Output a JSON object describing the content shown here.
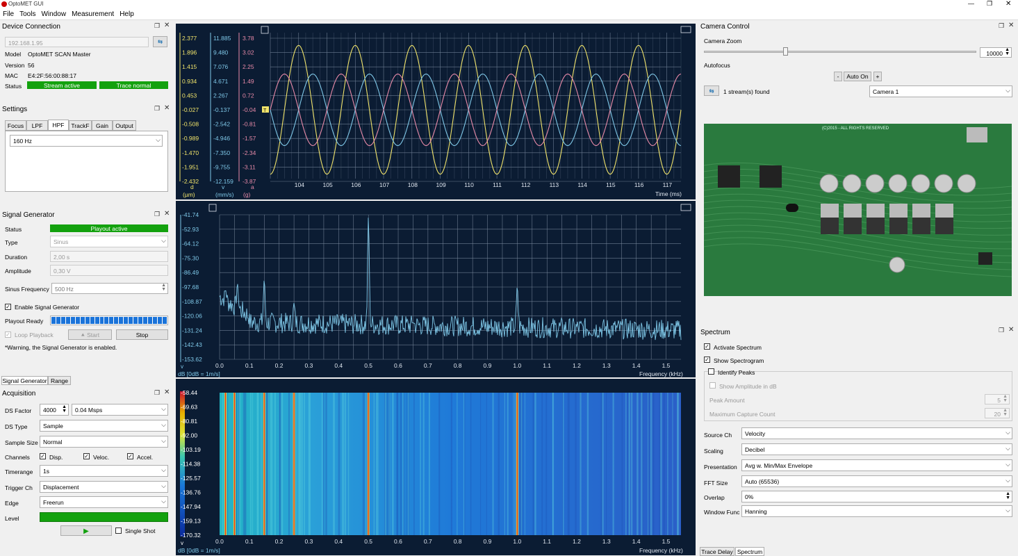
{
  "app": {
    "title": "OptoMET GUI",
    "menu": [
      "File",
      "Tools",
      "Window",
      "Measurement",
      "Help"
    ]
  },
  "device": {
    "title": "Device Connection",
    "ip": "192.168.1.95",
    "model_label": "Model",
    "model": "OptoMET SCAN Master",
    "version_label": "Version",
    "version": "56",
    "mac_label": "MAC",
    "mac": "E4:2F:56:00:88:17",
    "status_label": "Status",
    "stream": "Stream active",
    "trace": "Trace normal"
  },
  "settings": {
    "title": "Settings",
    "tabs": [
      "Focus",
      "LPF",
      "HPF",
      "TrackF",
      "Gain",
      "Output"
    ],
    "active_tab": "HPF",
    "hpf_value": "160 Hz"
  },
  "siggen": {
    "title": "Signal Generator",
    "status_label": "Status",
    "status": "Playout active",
    "type_label": "Type",
    "type": "Sinus",
    "duration_label": "Duration",
    "duration": "2,00 s",
    "amplitude_label": "Amplitude",
    "amplitude": "0,30 V",
    "freq_label": "Sinus Frequency",
    "freq": "500 Hz",
    "enable_label": "Enable Signal Generator",
    "ready_label": "Playout Ready",
    "loop_label": "Loop Playback",
    "start": "Start",
    "stop": "Stop",
    "warning": "*Warning, the Signal Generator is enabled.",
    "ready_segments": 24
  },
  "bottom_tabs": [
    "Signal Generator",
    "Range"
  ],
  "acq": {
    "title": "Acquisition",
    "ds_factor_label": "DS Factor",
    "ds_factor": "4000",
    "ds_rate": "0.04 Msps",
    "ds_type_label": "DS Type",
    "ds_type": "Sample",
    "sample_size_label": "Sample Size",
    "sample_size": "Normal",
    "channels_label": "Channels",
    "ch_disp": "Disp.",
    "ch_veloc": "Veloc.",
    "ch_accel": "Accel.",
    "timerange_label": "Timerange",
    "timerange": "1s",
    "trigger_label": "Trigger Ch",
    "trigger": "Displacement",
    "edge_label": "Edge",
    "edge": "Freerun",
    "level_label": "Level",
    "single_shot": "Single Shot"
  },
  "camera": {
    "title": "Camera Control",
    "zoom_label": "Camera Zoom",
    "zoom": "10000",
    "zoom_level": 0.3,
    "autofocus_label": "Autofocus",
    "minus": "-",
    "auto_on": "Auto On",
    "plus": "+",
    "streams": "1 stream(s) found",
    "camera": "Camera 1",
    "pcb_text": "(C)2015 - ALL RIGHTS RESERVED"
  },
  "spectrum": {
    "title": "Spectrum",
    "activate": "Activate Spectrum",
    "show_spectrogram": "Show Spectrogram",
    "identify_peaks": "Identify Peaks",
    "show_amp": "Show Amplitude in dB",
    "peak_amount_label": "Peak Amount",
    "peak_amount": "5",
    "max_capture_label": "Maximum Capture Count",
    "max_capture": "20",
    "source_label": "Source Ch",
    "source": "Velocity",
    "scaling_label": "Scaling",
    "scaling": "Decibel",
    "presentation_label": "Presentation",
    "presentation": "Avg w. Min/Max Envelope",
    "fft_label": "FFT Size",
    "fft": "Auto (65536)",
    "overlap_label": "Overlap",
    "overlap": "0%",
    "window_label": "Window Func",
    "window": "Hanning",
    "bottom_tabs": [
      "Trace Delay",
      "Spectrum"
    ]
  },
  "colors": {
    "plot_bg": "#0b1c33",
    "disp": "#f0e36a",
    "veloc": "#7fc8e8",
    "accel": "#e88aa8",
    "green": "#13a10e"
  },
  "chart_data": [
    {
      "type": "line",
      "title": "",
      "xlabel": "Time (ms)",
      "xlim": [
        103,
        117.5
      ],
      "x_ticks": [
        "104",
        "105",
        "106",
        "107",
        "108",
        "109",
        "110",
        "111",
        "112",
        "113",
        "114",
        "115",
        "116",
        "117"
      ],
      "axes": [
        {
          "label": "d",
          "unit": "(µm)",
          "ticks": [
            "2.377",
            "1.896",
            "1.415",
            "0.934",
            "0.453",
            "-0.027",
            "-0.508",
            "-0.989",
            "-1.470",
            "-1.951",
            "-2.432"
          ]
        },
        {
          "label": "v",
          "unit": "(mm/s)",
          "ticks": [
            "11.885",
            "9.480",
            "7.076",
            "4.671",
            "2.267",
            "-0.137",
            "-2.542",
            "-4.946",
            "-7.350",
            "-9.755",
            "-12.159"
          ]
        },
        {
          "label": "a",
          "unit": "(g)",
          "ticks": [
            "3.78",
            "3.02",
            "2.25",
            "1.49",
            "0.72",
            "-0.04",
            "-0.81",
            "-1.57",
            "-2.34",
            "-3.11",
            "-3.87"
          ]
        }
      ],
      "series": [
        {
          "frequency_hz": 500,
          "amplitude_fraction": 0.9,
          "phase": 1.57
        },
        {
          "frequency_hz": 500,
          "amplitude_fraction": 0.5,
          "phase": 0
        },
        {
          "frequency_hz": 500,
          "amplitude_fraction": 0.5,
          "phase": 3.14
        }
      ],
      "trigger_marker": "T"
    },
    {
      "type": "line",
      "title": "",
      "xlabel": "Frequency (kHz)",
      "ylabel": "dB [0dB = 1m/s]",
      "y_axis_name": "v",
      "xlim": [
        0,
        1.55
      ],
      "ylim": [
        -153.62,
        -41.74
      ],
      "x_ticks": [
        "0.0",
        "0.1",
        "0.2",
        "0.3",
        "0.4",
        "0.5",
        "0.6",
        "0.7",
        "0.8",
        "0.9",
        "1.0",
        "1.1",
        "1.2",
        "1.3",
        "1.4",
        "1.5"
      ],
      "y_ticks": [
        "-41.74",
        "-52.93",
        "-64.12",
        "-75.30",
        "-86.49",
        "-97.68",
        "-108.87",
        "-120.06",
        "-131.24",
        "-142.43",
        "-153.62"
      ],
      "peaks": [
        {
          "x": 0.02,
          "y": -100
        },
        {
          "x": 0.06,
          "y": -95
        },
        {
          "x": 0.15,
          "y": -92
        },
        {
          "x": 0.25,
          "y": -110
        },
        {
          "x": 0.5,
          "y": -43
        },
        {
          "x": 0.65,
          "y": -125
        },
        {
          "x": 1.0,
          "y": -97
        }
      ]
    },
    {
      "type": "heatmap",
      "title": "",
      "xlabel": "Frequency (kHz)",
      "ylabel": "dB [0dB = 1m/s]",
      "y_axis_name": "v",
      "x_ticks": [
        "0.0",
        "0.1",
        "0.2",
        "0.3",
        "0.4",
        "0.5",
        "0.6",
        "0.7",
        "0.8",
        "0.9",
        "1.0",
        "1.1",
        "1.2",
        "1.3",
        "1.4",
        "1.5"
      ],
      "color_ticks": [
        "-58.44",
        "-69.63",
        "-80.81",
        "-92.00",
        "-103.19",
        "-114.38",
        "-125.57",
        "-136.76",
        "-147.94",
        "-159.13",
        "-170.32"
      ],
      "lines_khz": [
        0.02,
        0.05,
        0.15,
        0.25,
        0.5,
        1.0
      ]
    }
  ]
}
